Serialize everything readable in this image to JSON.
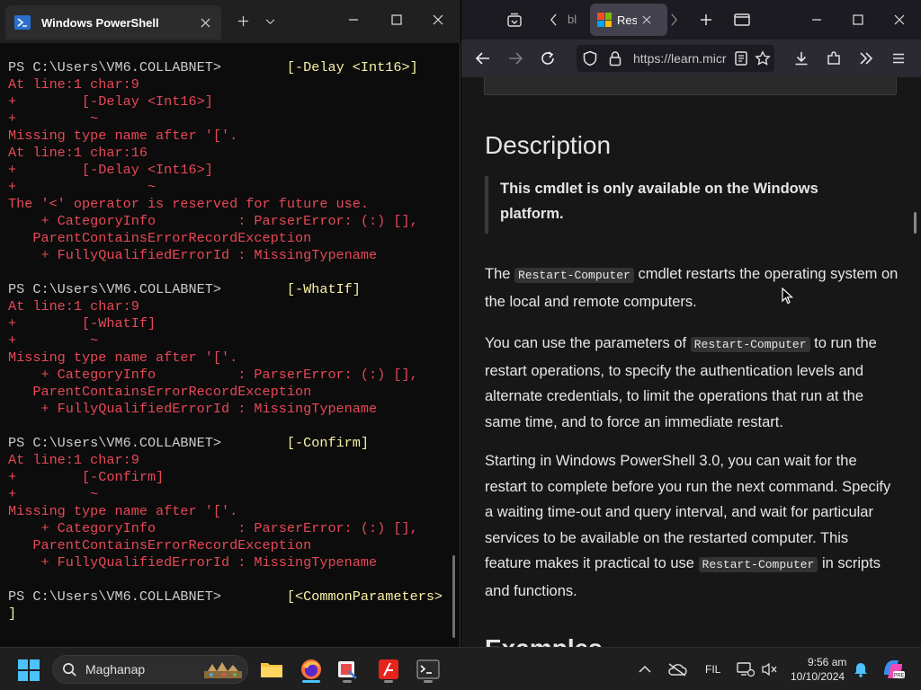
{
  "terminal": {
    "tab_title": "Windows PowerShell",
    "lines": [
      {
        "segs": [
          {
            "t": "PS C:\\Users\\VM6.COLLABNET>",
            "c": "white"
          },
          {
            "t": "        [-Delay <Int16>]",
            "c": "yellow"
          }
        ]
      },
      {
        "segs": [
          {
            "t": "At line:1 char:9",
            "c": "red"
          }
        ]
      },
      {
        "segs": [
          {
            "t": "+        [-Delay <Int16>]",
            "c": "red"
          }
        ]
      },
      {
        "segs": [
          {
            "t": "+         ~",
            "c": "red"
          }
        ]
      },
      {
        "segs": [
          {
            "t": "Missing type name after '['.",
            "c": "red"
          }
        ]
      },
      {
        "segs": [
          {
            "t": "At line:1 char:16",
            "c": "red"
          }
        ]
      },
      {
        "segs": [
          {
            "t": "+        [-Delay <Int16>]",
            "c": "red"
          }
        ]
      },
      {
        "segs": [
          {
            "t": "+                ~",
            "c": "red"
          }
        ]
      },
      {
        "segs": [
          {
            "t": "The '<' operator is reserved for future use.",
            "c": "red"
          }
        ]
      },
      {
        "segs": [
          {
            "t": "    + CategoryInfo          : ParserError: (:) [],",
            "c": "red"
          }
        ]
      },
      {
        "segs": [
          {
            "t": "   ParentContainsErrorRecordException",
            "c": "red"
          }
        ]
      },
      {
        "segs": [
          {
            "t": "    + FullyQualifiedErrorId : MissingTypename",
            "c": "red"
          }
        ]
      },
      {
        "segs": [
          {
            "t": "",
            "c": "white"
          }
        ]
      },
      {
        "segs": [
          {
            "t": "PS C:\\Users\\VM6.COLLABNET>",
            "c": "white"
          },
          {
            "t": "        [-WhatIf]",
            "c": "yellow"
          }
        ]
      },
      {
        "segs": [
          {
            "t": "At line:1 char:9",
            "c": "red"
          }
        ]
      },
      {
        "segs": [
          {
            "t": "+        [-WhatIf]",
            "c": "red"
          }
        ]
      },
      {
        "segs": [
          {
            "t": "+         ~",
            "c": "red"
          }
        ]
      },
      {
        "segs": [
          {
            "t": "Missing type name after '['.",
            "c": "red"
          }
        ]
      },
      {
        "segs": [
          {
            "t": "    + CategoryInfo          : ParserError: (:) [],",
            "c": "red"
          }
        ]
      },
      {
        "segs": [
          {
            "t": "   ParentContainsErrorRecordException",
            "c": "red"
          }
        ]
      },
      {
        "segs": [
          {
            "t": "    + FullyQualifiedErrorId : MissingTypename",
            "c": "red"
          }
        ]
      },
      {
        "segs": [
          {
            "t": "",
            "c": "white"
          }
        ]
      },
      {
        "segs": [
          {
            "t": "PS C:\\Users\\VM6.COLLABNET>",
            "c": "white"
          },
          {
            "t": "        [-Confirm]",
            "c": "yellow"
          }
        ]
      },
      {
        "segs": [
          {
            "t": "At line:1 char:9",
            "c": "red"
          }
        ]
      },
      {
        "segs": [
          {
            "t": "+        [-Confirm]",
            "c": "red"
          }
        ]
      },
      {
        "segs": [
          {
            "t": "+         ~",
            "c": "red"
          }
        ]
      },
      {
        "segs": [
          {
            "t": "Missing type name after '['.",
            "c": "red"
          }
        ]
      },
      {
        "segs": [
          {
            "t": "    + CategoryInfo          : ParserError: (:) [],",
            "c": "red"
          }
        ]
      },
      {
        "segs": [
          {
            "t": "   ParentContainsErrorRecordException",
            "c": "red"
          }
        ]
      },
      {
        "segs": [
          {
            "t": "    + FullyQualifiedErrorId : MissingTypename",
            "c": "red"
          }
        ]
      },
      {
        "segs": [
          {
            "t": "",
            "c": "white"
          }
        ]
      },
      {
        "segs": [
          {
            "t": "PS C:\\Users\\VM6.COLLABNET>",
            "c": "white"
          },
          {
            "t": "        [<CommonParameters>",
            "c": "yellow"
          }
        ]
      },
      {
        "segs": [
          {
            "t": "]",
            "c": "yellow"
          }
        ]
      }
    ]
  },
  "browser": {
    "partial_tab_label": "bl",
    "active_tab_label": "Res",
    "url": "https://learn.micr",
    "content": {
      "heading": "Description",
      "note": "This cmdlet is only available on the Windows platform.",
      "p1_before": "The ",
      "p1_code": "Restart-Computer",
      "p1_after": " cmdlet restarts the operating system on the local and remote computers.",
      "p2_before": "You can use the parameters of ",
      "p2_code": "Restart-Computer",
      "p2_after": " to run the restart operations, to specify the authentication levels and alternate credentials, to limit the operations that run at the same time, and to force an immediate restart.",
      "p3_before": "Starting in Windows PowerShell 3.0, you can wait for the restart to complete before you run the next command. Specify a waiting time-out and query interval, and wait for particular services to be available on the restarted computer. This feature makes it practical to use ",
      "p3_code": "Restart-Computer",
      "p3_after": " in scripts and functions.",
      "next_heading": "Examples"
    }
  },
  "taskbar": {
    "search_label": "Maghanap",
    "language": "FIL",
    "time": "9:56 am",
    "date": "10/10/2024"
  },
  "colors": {
    "terminal_red": "#e74856",
    "terminal_yellow": "#f9f1a5",
    "terminal_white": "#cccccc",
    "accent_blue": "#4cc2ff"
  }
}
